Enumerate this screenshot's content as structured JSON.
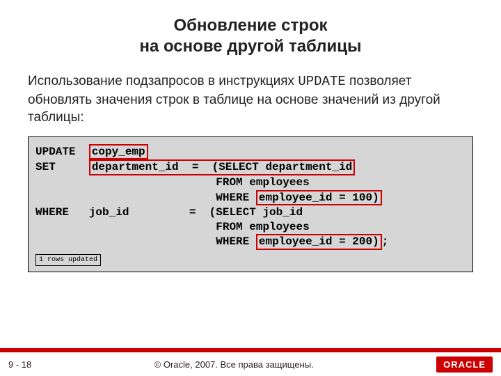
{
  "title_line1": "Обновление строк",
  "title_line2": "на основе другой таблицы",
  "desc_part1": "Использование подзапросов в инструкциях ",
  "desc_mono": "UPDATE",
  "desc_part2": " позволяет обновлять значения строк в таблице на основе значений из другой таблицы:",
  "code": {
    "l1a": "UPDATE  ",
    "l1b": "copy_emp",
    "l2a": "SET     ",
    "l2b": "department_id  =  (SELECT department_id",
    "l3": "                           FROM employees",
    "l4a": "                           WHERE ",
    "l4b": "employee_id = 100)",
    "l5": "WHERE   job_id         =  (SELECT job_id",
    "l6": "                           FROM employees",
    "l7a": "                           WHERE ",
    "l7b": "employee_id = 200)",
    "l7c": ";"
  },
  "result": "1 rows updated",
  "footer": {
    "page": "9 - 18",
    "copyright": "© Oracle, 2007. Все права защищены.",
    "logo": "ORACLE"
  }
}
